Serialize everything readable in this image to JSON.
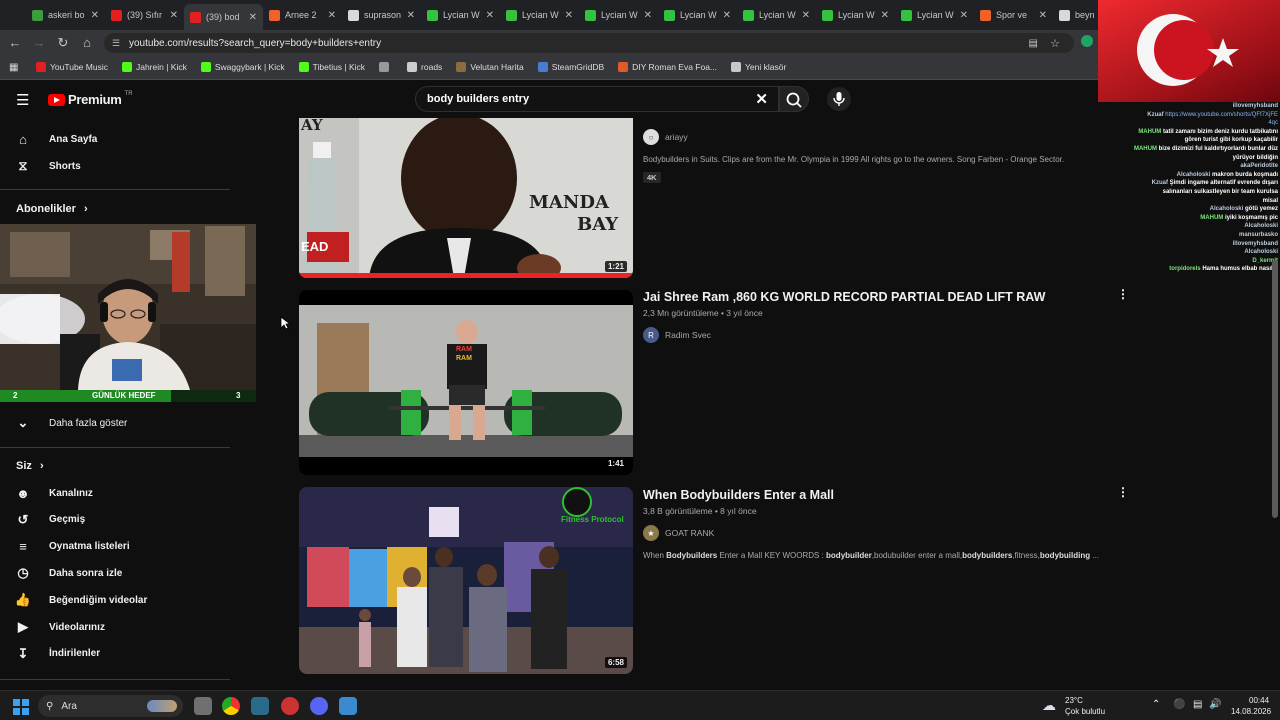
{
  "tabs": [
    {
      "title": "askeri bo",
      "color": "#3c9d3c"
    },
    {
      "title": "(39) Sıfır",
      "color": "#e32020"
    },
    {
      "title": "(39) bod",
      "color": "#e32020",
      "active": true
    },
    {
      "title": "Arnee 2",
      "color": "#f0622a"
    },
    {
      "title": "suprason",
      "color": "#d9d9d9"
    },
    {
      "title": "Lycian W",
      "color": "#34c240"
    },
    {
      "title": "Lycian W",
      "color": "#34c240"
    },
    {
      "title": "Lycian W",
      "color": "#34c240"
    },
    {
      "title": "Lycian W",
      "color": "#34c240"
    },
    {
      "title": "Lycian W",
      "color": "#34c240"
    },
    {
      "title": "Lycian W",
      "color": "#34c240"
    },
    {
      "title": "Lycian W",
      "color": "#34c240"
    },
    {
      "title": "Spor ve",
      "color": "#f0622a"
    },
    {
      "title": "beyn",
      "color": "#d9d9d9"
    }
  ],
  "url": "youtube.com/results?search_query=body+builders+entry",
  "bookmarks": [
    {
      "label": "YouTube Music",
      "color": "#e32020"
    },
    {
      "label": "Jahrein | Kick",
      "color": "#53fc18"
    },
    {
      "label": "Swaggybark | Kick",
      "color": "#53fc18"
    },
    {
      "label": "Tibetius | Kick",
      "color": "#53fc18"
    },
    {
      "label": "",
      "color": "#999999"
    },
    {
      "label": "roads",
      "color": "#cccccc"
    },
    {
      "label": "Velutan Harita",
      "color": "#8a6d3b"
    },
    {
      "label": "SteamGridDB",
      "color": "#4a7bd0"
    },
    {
      "label": "DIY Roman Eva Foa...",
      "color": "#e05a2a"
    },
    {
      "label": "Yeni klasör",
      "color": "#c8c8c8"
    }
  ],
  "header": {
    "logo": "Premium",
    "logo_region": "TR",
    "search_value": "body builders entry"
  },
  "sidebar": {
    "home": "Ana Sayfa",
    "shorts": "Shorts",
    "subs_heading": "Abonelikler",
    "goal_left": "2",
    "goal_label": "GÜNLÜK HEDEF",
    "goal_right": "3",
    "goal_progress": 0.667,
    "show_more": "Daha fazla göster",
    "you_heading": "Siz",
    "you_items": [
      "Kanalınız",
      "Geçmiş",
      "Oynatma listeleri",
      "Daha sonra izle",
      "Beğendiğim videolar",
      "Videolarınız",
      "İndirilenler"
    ]
  },
  "videos": [
    {
      "title": "",
      "meta": "",
      "channel": "ariayy",
      "desc": "Bodybuilders in Suits. Clips are from the Mr. Olympia in 1999 All rights go to the owners. Song Farben - Orange Sector.",
      "badge": "4K",
      "duration": "1:21",
      "thumb_text": [
        "AY",
        "MANDA",
        "BAY",
        "EAD"
      ]
    },
    {
      "title": "Jai Shree Ram ,860 KG WORLD RECORD PARTIAL DEAD LIFT RAW",
      "meta": "2,3 Mn görüntüleme • 3 yıl önce",
      "channel": "Radim Svec",
      "avatar_letter": "R",
      "duration": "1:41",
      "thumb_text": [
        "RAM",
        "RAM"
      ]
    },
    {
      "title": "When Bodybuilders Enter a Mall",
      "meta": "3,8 B görüntüleme • 8 yıl önce",
      "channel": "GOAT RANK",
      "desc_plain1": "When ",
      "desc_bold1": "Bodybuilders",
      "desc_plain2": " Enter a Mall KEY WOORDS : ",
      "desc_bold2": "bodybuilder",
      "desc_plain3": ",bodubuilder enter a mall,",
      "desc_bold3": "bodybuilders",
      "desc_plain4": ",fitness,",
      "desc_bold4": "bodybuilding",
      "desc_plain5": " ...",
      "duration": "6:58",
      "thumb_text": [
        "Fitness Protocol"
      ]
    }
  ],
  "chat": [
    {
      "user": "illovemyhsband",
      "msg": ""
    },
    {
      "user": "Kzuaf",
      "msg": "https://www.youtube.com/shorts/QFf7XjFE",
      "link": true
    },
    {
      "user": "",
      "msg": "4qc",
      "link": true
    },
    {
      "user": "MAHUM",
      "msg": "tatil zamanı bizim deniz kurdu tatbikatını",
      "green": true
    },
    {
      "user": "",
      "msg": "gören turist gibi korkup kaçabilir"
    },
    {
      "user": "MAHUM",
      "msg": "bize dizimizi ful kaldırtıyorlardı bunlar düz",
      "green": true
    },
    {
      "user": "",
      "msg": "yürüyor bildiğin"
    },
    {
      "user": "akaPeridotite",
      "msg": ""
    },
    {
      "user": "Alcaholoski",
      "msg": "makron burda koşmadı"
    },
    {
      "user": "Kzuaf",
      "msg": "Şimdi ingame alternatif evrende dışarı"
    },
    {
      "user": "",
      "msg": "salınanları suikastleyen bir team kurulsa"
    },
    {
      "user": "",
      "msg": "misal"
    },
    {
      "user": "Alcaholoski",
      "msg": "götü yemez"
    },
    {
      "user": "MAHUM",
      "msg": "iyiki koşmamış pic",
      "green": true
    },
    {
      "user": "Alcaholoski",
      "msg": ""
    },
    {
      "user": "mansurbasko",
      "msg": ""
    },
    {
      "user": "illovemyhsband",
      "msg": ""
    },
    {
      "user": "Alcaholoski",
      "msg": ""
    },
    {
      "user": "D_kermit",
      "msg": "",
      "green": true
    },
    {
      "user": "torpidorels",
      "msg": "Hama humus elbab nasıl ?",
      "green": true
    }
  ],
  "taskbar": {
    "search_placeholder": "Ara",
    "weather_temp": "23°C",
    "weather_desc": "Çok bulutlu",
    "time": "00:44",
    "date": "14.08.2026"
  }
}
